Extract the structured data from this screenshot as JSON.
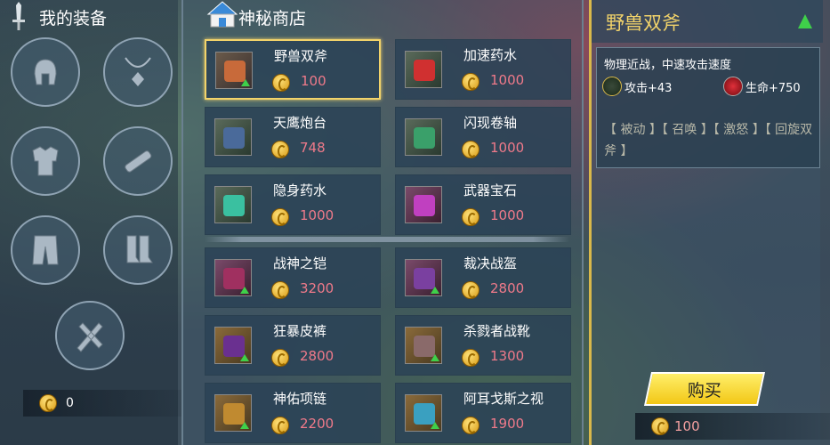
{
  "equipment": {
    "title": "我的装备",
    "gold": "0"
  },
  "shop": {
    "title": "神秘商店",
    "items": [
      {
        "name": "野兽双斧",
        "price": "100",
        "selected": true
      },
      {
        "name": "加速药水",
        "price": "1000"
      },
      {
        "name": "天鹰炮台",
        "price": "748"
      },
      {
        "name": "闪现卷轴",
        "price": "1000"
      },
      {
        "name": "隐身药水",
        "price": "1000"
      },
      {
        "name": "武器宝石",
        "price": "1000"
      },
      {
        "name": "战神之铠",
        "price": "3200"
      },
      {
        "name": "裁决战盔",
        "price": "2800"
      },
      {
        "name": "狂暴皮裤",
        "price": "2800"
      },
      {
        "name": "杀戮者战靴",
        "price": "1300"
      },
      {
        "name": "神佑项链",
        "price": "2200"
      },
      {
        "name": "阿耳戈斯之视",
        "price": "1900"
      }
    ]
  },
  "detail": {
    "name": "野兽双斧",
    "desc": "物理近战，中速攻击速度",
    "attack": "攻击+43",
    "hp": "生命+750",
    "tags": "【 被动 】【 召唤 】【 激怒 】【 回旋双斧 】",
    "buy": "购买",
    "cost": "100"
  },
  "colors": {
    "accent": "#f2d36a",
    "price": "#f07a8a",
    "upgrade": "#3fd04a"
  }
}
